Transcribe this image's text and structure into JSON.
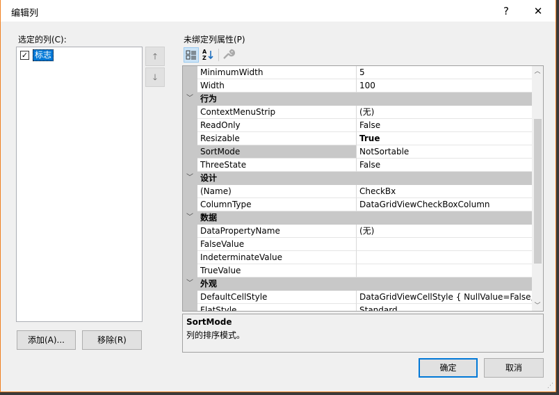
{
  "window": {
    "title": "编辑列",
    "help_label": "?",
    "close_label": "✕"
  },
  "left": {
    "label": "选定的列(C):",
    "items": [
      {
        "label": "标志",
        "checked": true
      }
    ],
    "up_label": "🡑",
    "down_label": "🡓",
    "add_label": "添加(A)...",
    "remove_label": "移除(R)"
  },
  "right": {
    "label": "未绑定列属性(P)",
    "toolbar": {
      "categorized": "categorized-icon",
      "alphabetical": "alphabetical-icon",
      "property_pages": "wrench-icon"
    },
    "rows": [
      {
        "name": "MinimumWidth",
        "value": "5"
      },
      {
        "name": "Width",
        "value": "100"
      },
      {
        "category": "行为"
      },
      {
        "name": "ContextMenuStrip",
        "value": "(无)"
      },
      {
        "name": "ReadOnly",
        "value": "False"
      },
      {
        "name": "Resizable",
        "value": "True",
        "bold": true
      },
      {
        "name": "SortMode",
        "value": "NotSortable",
        "selected": true
      },
      {
        "name": "ThreeState",
        "value": "False"
      },
      {
        "category": "设计"
      },
      {
        "name": "(Name)",
        "value": "CheckBx"
      },
      {
        "name": "ColumnType",
        "value": "DataGridViewCheckBoxColumn"
      },
      {
        "category": "数据"
      },
      {
        "name": "DataPropertyName",
        "value": "(无)"
      },
      {
        "name": "FalseValue",
        "value": ""
      },
      {
        "name": "IndeterminateValue",
        "value": ""
      },
      {
        "name": "TrueValue",
        "value": ""
      },
      {
        "category": "外观"
      },
      {
        "name": "DefaultCellStyle",
        "value": "DataGridViewCellStyle { NullValue=False, A"
      },
      {
        "name": "FlatStyle",
        "value": "Standard"
      }
    ],
    "description": {
      "title": "SortMode",
      "text": "列的排序模式。"
    }
  },
  "buttons": {
    "ok": "确定",
    "cancel": "取消"
  }
}
